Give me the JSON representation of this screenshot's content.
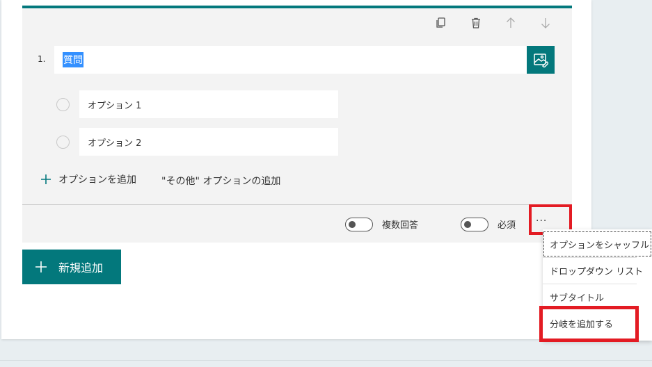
{
  "question": {
    "number": "1.",
    "title_value": "質問",
    "options": [
      {
        "label": "オプション 1"
      },
      {
        "label": "オプション 2"
      }
    ],
    "add_option_label": "オプションを追加",
    "add_other_label": "\"その他\" オプションの追加",
    "multiple_answers_label": "複数回答",
    "required_label": "必須",
    "more_label": "..."
  },
  "toolbar": {
    "icons": [
      "copy-icon",
      "delete-icon",
      "arrow-up-icon",
      "arrow-down-icon"
    ]
  },
  "add_new": {
    "label": "新規追加"
  },
  "menu": {
    "items": [
      {
        "label": "オプションをシャッフル"
      },
      {
        "label": "ドロップダウン リスト"
      },
      {
        "label": "サブタイトル"
      },
      {
        "label": "分岐を追加する"
      }
    ]
  },
  "colors": {
    "accent": "#03787c",
    "highlight": "#e31b23",
    "selection": "#3390ff"
  }
}
